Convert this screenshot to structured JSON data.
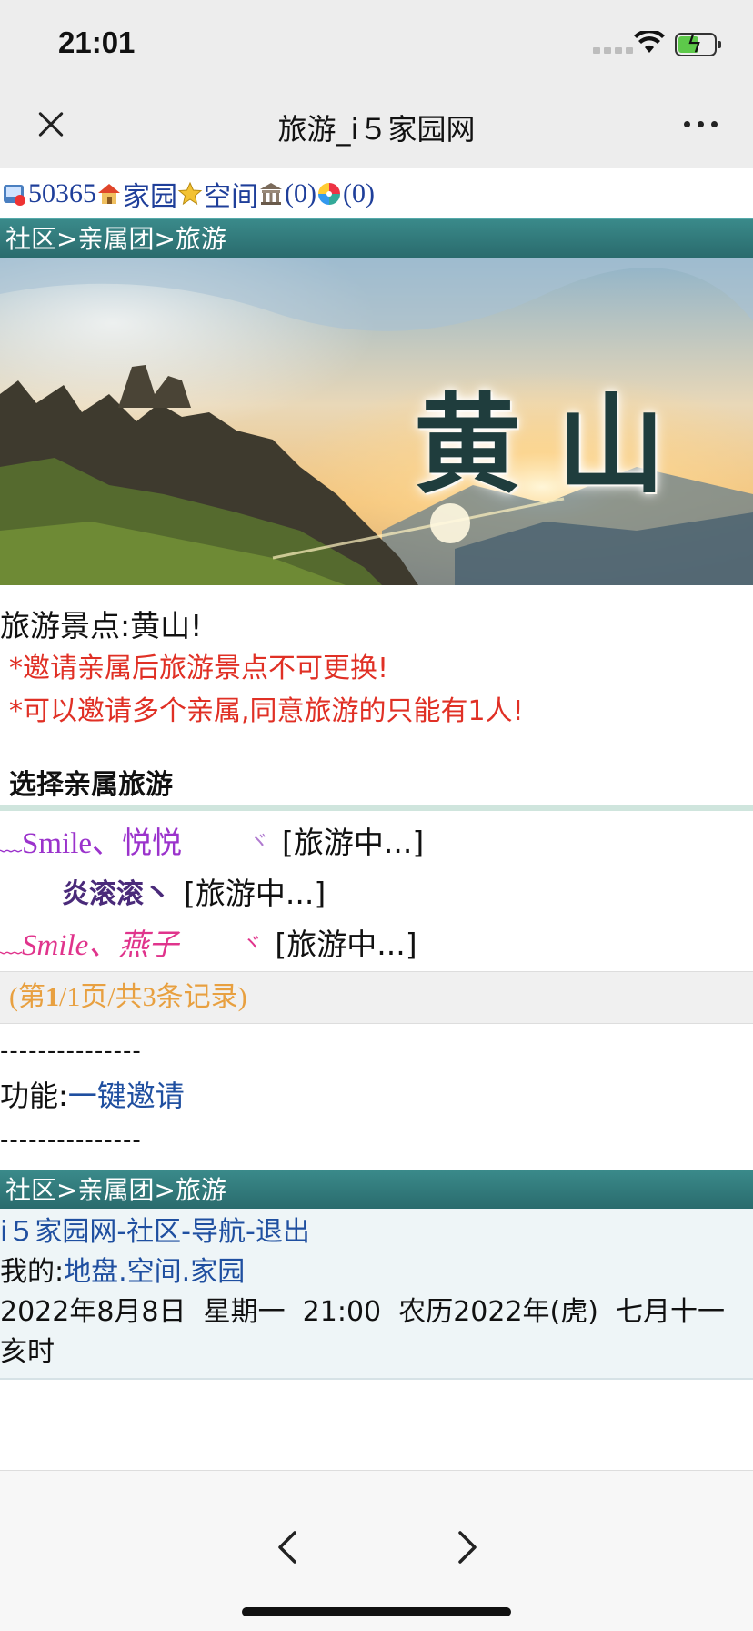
{
  "status_bar": {
    "time": "21:01"
  },
  "nav": {
    "title": "旅游_i５家园网"
  },
  "top_links": {
    "points": "50365",
    "home": "家园",
    "space": "空间",
    "bank_count": "(0)",
    "other_count": "(0)"
  },
  "breadcrumb": "社区>亲属团>旅游",
  "banner": {
    "title": "黄山"
  },
  "info": {
    "spot": "旅游景点:黄山!",
    "note1": "*邀请亲属后旅游景点不可更换!",
    "note2": "*可以邀请多个亲属,同意旅游的只能有1人!"
  },
  "section_title": "选择亲属旅游",
  "relatives": [
    {
      "prefix": "﹏",
      "name": "Smile、悦悦",
      "suffix": "ヾ",
      "status": "[旅游中...]",
      "color": "#9b33cc"
    },
    {
      "prefix": "",
      "name": "炎滚滚丶",
      "suffix": "",
      "status": "[旅游中...]",
      "color": "#4a2a7a"
    },
    {
      "prefix": "﹏",
      "name": "Smile、燕子",
      "suffix": "ヾ",
      "status": "[旅游中...]",
      "color": "#e0348c"
    }
  ],
  "pager": {
    "open": "(第",
    "page": "1",
    "rest": "/1页/共3条记录)"
  },
  "divider": "---------------",
  "function": {
    "label": "功能:",
    "link": "一键邀请"
  },
  "footer": {
    "site": "i５家园网",
    "sep1": "-",
    "community": "社区",
    "sep2": "-",
    "guide": "导航",
    "sep3": "-",
    "logout": "退出",
    "mine_label": "我的:",
    "land": "地盘",
    "dot1": ".",
    "space": "空间",
    "dot2": ".",
    "home": "家园",
    "datetime": "2022年8月8日  星期一  21:00  农历2022年(虎)  七月十一  亥时"
  },
  "colors": {
    "teal_bar": "#2f7475",
    "link_blue": "#1f4fa0",
    "warning_red": "#e03025",
    "pager_orange": "#e8a040"
  },
  "icons": [
    "user-icon",
    "house-icon",
    "star-icon",
    "bank-icon",
    "pinwheel-icon",
    "close-icon",
    "more-icon",
    "back-chevron-icon",
    "forward-chevron-icon"
  ]
}
